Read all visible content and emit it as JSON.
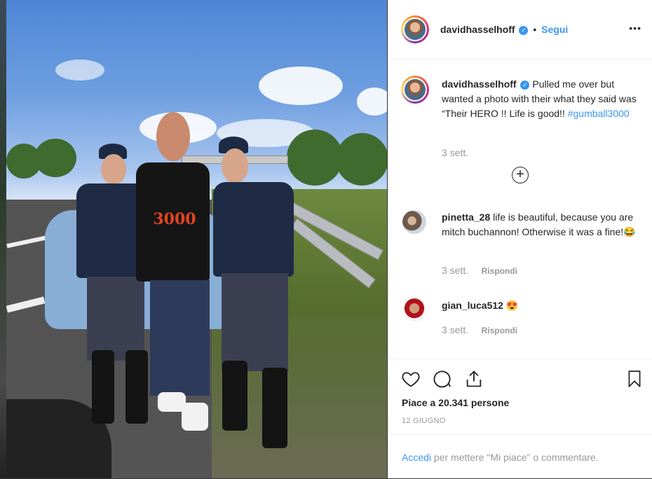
{
  "post": {
    "author": "davidhasselhoff",
    "follow_label": "Segui",
    "more_label": "•••",
    "caption": "Pulled me over but wanted a photo with their what they said was “Their HERO !! Life is good!! ",
    "hashtag": "#gumball3000",
    "caption_time": "3 sett.",
    "load_more_icon": "plus-circle-icon"
  },
  "comments": [
    {
      "user": "pinetta_28",
      "text": "life is beautiful, because you are mitch buchannon! Otherwise it was a fine!😂",
      "time": "3 sett.",
      "reply_label": "Rispondi"
    },
    {
      "user": "gian_luca512",
      "text": "😍",
      "time": "3 sett.",
      "reply_label": "Rispondi"
    }
  ],
  "actions": {
    "likes": "Piace a 20.341 persone",
    "date": "12 GIUGNO"
  },
  "login": {
    "link": "Accedi",
    "text": " per mettere \"Mi piace\" o commentare."
  },
  "photo": {
    "jersey_text": "3000"
  },
  "colors": {
    "accent": "#3897f0",
    "text": "#262626",
    "muted": "#999999"
  }
}
